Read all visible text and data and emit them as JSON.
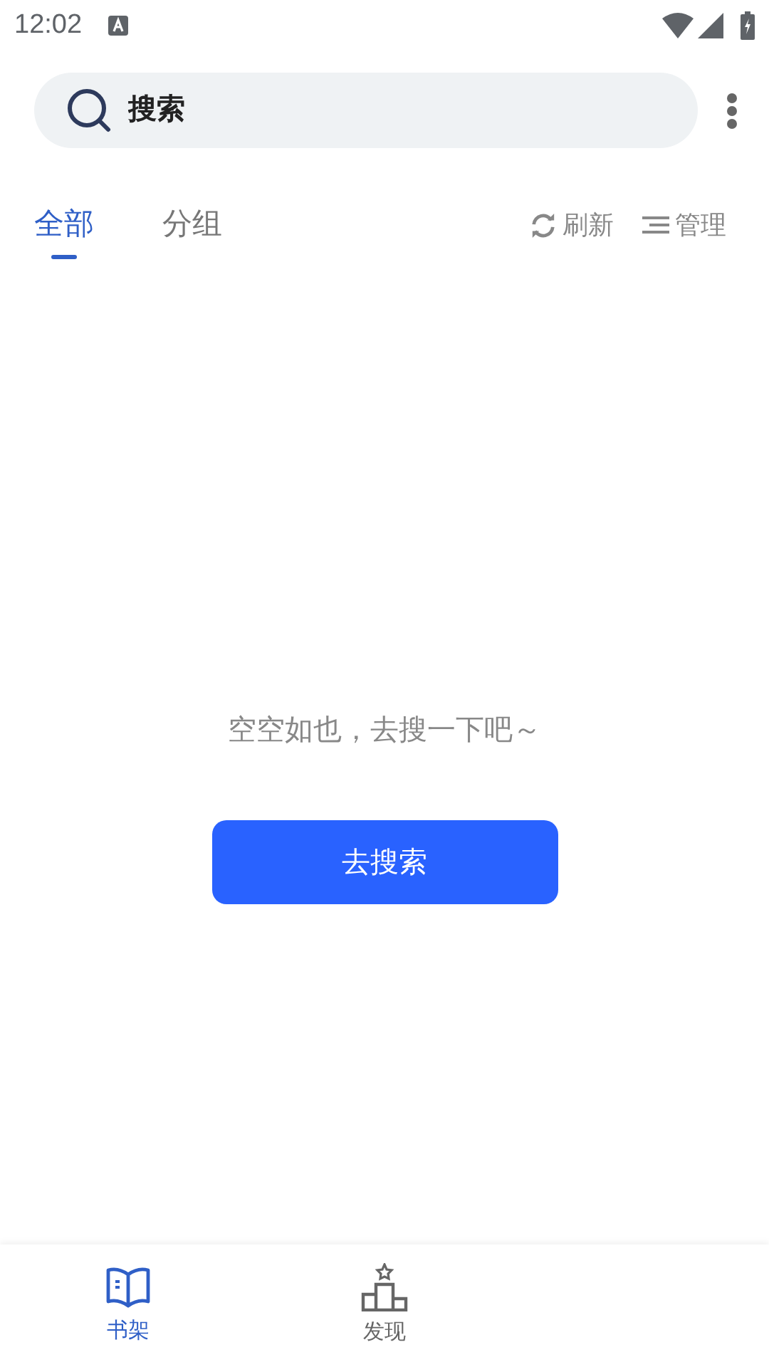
{
  "status_bar": {
    "time": "12:02"
  },
  "search": {
    "placeholder": "搜索"
  },
  "tabs": [
    {
      "label": "全部",
      "selected": true
    },
    {
      "label": "分组",
      "selected": false
    }
  ],
  "actions": [
    {
      "kind": "refresh",
      "label": "刷新"
    },
    {
      "kind": "manage",
      "label": "管理"
    }
  ],
  "empty_state": {
    "message": "空空如也，去搜一下吧～",
    "button": "去搜索"
  },
  "bottom_nav": [
    {
      "kind": "bookshelf",
      "label": "书架",
      "selected": true
    },
    {
      "kind": "discover",
      "label": "发现",
      "selected": false
    }
  ]
}
